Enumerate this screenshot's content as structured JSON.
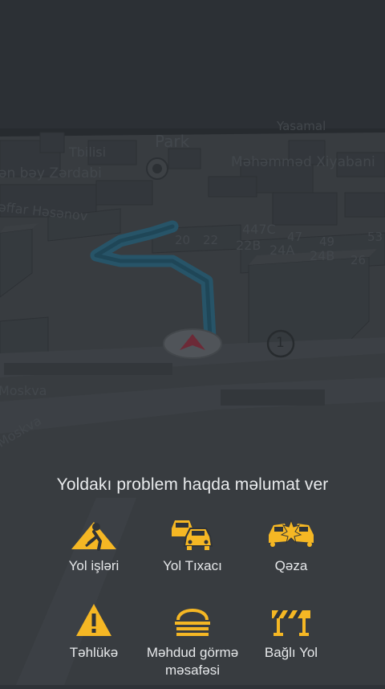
{
  "map": {
    "labels": {
      "yasamal": "Yasamal",
      "tbilisi": "Tbilisi",
      "park": "Park",
      "mehemmed": "Məhəmməd Xiyabani",
      "zerdabi": "ən bəy Zərdabi",
      "hesenov": "əffar Həsənov",
      "moskva1": "Moskva",
      "moskva2": "Moskva",
      "h20": "20",
      "h22": "22",
      "h447c": "447C",
      "h22b": "22B",
      "h47": "47",
      "h24a": "24A",
      "h49": "49",
      "h24b": "24B",
      "h53": "53",
      "h26": "26",
      "h1": "1"
    },
    "colors": {
      "route": "#2f8fb5",
      "arrow": "#c8324a"
    }
  },
  "report": {
    "title": "Yoldakı problem haqda məlumat ver",
    "accent": "#f5b724",
    "items": [
      {
        "label": "Yol işləri",
        "icon": "road-works-icon"
      },
      {
        "label": "Yol Tıxacı",
        "icon": "traffic-jam-icon"
      },
      {
        "label": "Qəza",
        "icon": "crash-icon"
      },
      {
        "label": "Təhlükə",
        "icon": "hazard-icon"
      },
      {
        "label": "Məhdud görmə məsafəsi",
        "icon": "fog-icon"
      },
      {
        "label": "Bağlı Yol",
        "icon": "road-closed-icon"
      }
    ]
  }
}
